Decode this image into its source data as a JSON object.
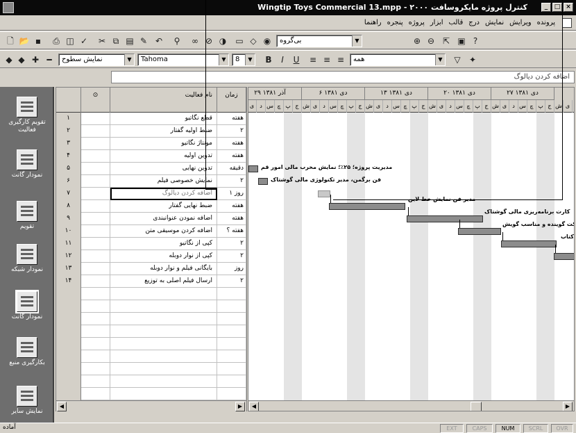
{
  "window": {
    "title": "Wingtip Toys Commercial 13.mpp - ۲۰۰۰ کنترل پروژه مایکروسافت",
    "controls": [
      "_",
      "□",
      "×"
    ]
  },
  "menu": {
    "items": [
      "پرونده",
      "ویرایش",
      "نمایش",
      "درج",
      "قالب",
      "ابزار",
      "پروژه",
      "پنجره",
      "راهنما"
    ]
  },
  "toolbar1": {
    "icons": [
      "new-icon",
      "open-icon",
      "save-icon",
      "print-icon",
      "preview-icon",
      "spell-icon",
      "cut-icon",
      "copy-icon",
      "paste-icon",
      "format-painter-icon",
      "undo-icon",
      "insert-hyperlink-icon",
      "link-icon",
      "unlink-icon",
      "split-icon",
      "task-info-icon",
      "notes-icon",
      "assign-icon"
    ],
    "group_combo": "بی‌گروه",
    "zoom_in": "⊕",
    "zoom_out": "⊖"
  },
  "toolbar2": {
    "outline_combo": "نمایش سطوح",
    "font_combo": "Tahoma",
    "size_combo": "8",
    "bold": "B",
    "italic": "I",
    "underline": "U",
    "filter_combo": "همه"
  },
  "entry": {
    "value": "اضافه کردن دیالوگ"
  },
  "viewbar": {
    "items": [
      {
        "label": "تقویم کارگیری فعالیت",
        "icon": "calendar-icon"
      },
      {
        "label": "نمودار گانت",
        "icon": "gantt-icon"
      },
      {
        "label": "تقویم",
        "icon": "calendar-view-icon"
      },
      {
        "label": "نمودار شبکه",
        "icon": "network-icon"
      },
      {
        "label": "نمودار گانت",
        "icon": "tracking-gantt-icon"
      },
      {
        "label": "بکارگیری منبع",
        "icon": "resource-usage-icon"
      },
      {
        "label": "نمایش سایر",
        "icon": "more-views-icon"
      }
    ]
  },
  "grid": {
    "header_info": "⊙",
    "header_name": "نام فعالیت",
    "header_dur": "زمان",
    "rows": [
      {
        "id": "۱",
        "name": "قطع نگاتیو",
        "dur": "هفته"
      },
      {
        "id": "۲",
        "name": "ضبط اولیه گفتار",
        "dur": "۲"
      },
      {
        "id": "۳",
        "name": "مونتاژ نگاتیو",
        "dur": "هفته"
      },
      {
        "id": "۴",
        "name": "تدوین اولیه",
        "dur": "هفته"
      },
      {
        "id": "۵",
        "name": "تدوین نهایی",
        "dur": "دقیقه"
      },
      {
        "id": "۶",
        "name": "نمایش خصوصی فیلم",
        "dur": "۲"
      },
      {
        "id": "۷",
        "name": "اضافه کردن دیالوگ",
        "dur": "۱ روز"
      },
      {
        "id": "۸",
        "name": "ضبط نهایی گفتار",
        "dur": "هفته"
      },
      {
        "id": "۹",
        "name": "اضافه نمودن عنوانبندی",
        "dur": "هفته"
      },
      {
        "id": "۱۰",
        "name": "اضافه کردن موسیقی متن",
        "dur": "هفته ؟"
      },
      {
        "id": "۱۱",
        "name": "کپی از نگاتیو",
        "dur": "۲"
      },
      {
        "id": "۱۲",
        "name": "کپی از نوار دوبله",
        "dur": "۲"
      },
      {
        "id": "۱۳",
        "name": "بایگانی فیلم و نوار دوبله",
        "dur": "روز"
      },
      {
        "id": "۱۴",
        "name": "ارسال فیلم اصلی به توزیع",
        "dur": "۲"
      }
    ]
  },
  "gantt": {
    "weeks": [
      "۲۹ آذر ۱۳۸۱",
      "۶ دی ۱۳۸۱",
      "۱۳ دی ۱۳۸۱",
      "۲۰ دی ۱۳۸۱",
      "۲۷ دی ۱۳۸۱"
    ],
    "days": [
      "ش",
      "ی",
      "د",
      "س",
      "چ",
      "پ",
      "ج"
    ],
    "labels": [
      "مدیریت پروژه؛ ۲۵٪؛ نمایش مخرب مالی امور قم",
      "فن برگمن، مدیر تکنولوژی مالی گوشتاک",
      "مدیر فن نمایش خط لاین",
      "کارت برنامه‌ریزی مالی گوشتاک",
      "شرکت گوینده و مناسب گویش",
      "کتاب"
    ]
  },
  "status": {
    "left": "آماده",
    "indicators": [
      "EXT",
      "CAPS",
      "NUM",
      "SCRL",
      "OVR"
    ]
  }
}
